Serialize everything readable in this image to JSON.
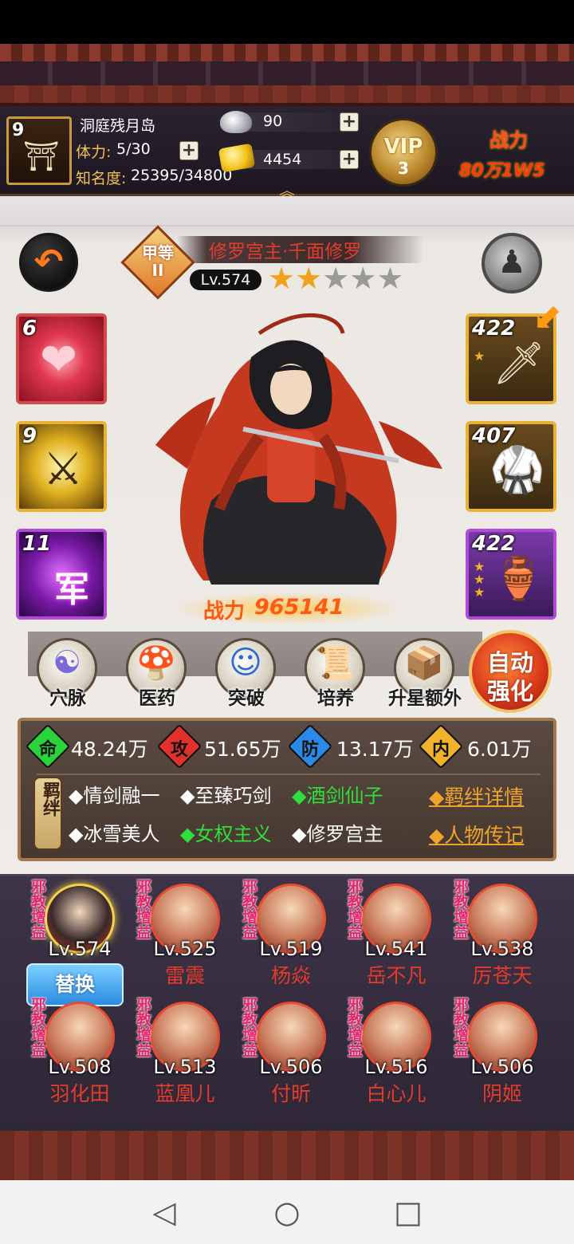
{
  "player": {
    "level": "9",
    "location": "洞庭残月岛",
    "stamina_label": "体力:",
    "stamina_value": "5/30",
    "fame_label": "知名度:",
    "fame_value": "25395/34800",
    "silver": "90",
    "gold": "4454",
    "vip_label": "VIP",
    "vip_level": "3",
    "power_label": "战力",
    "power_value": "80万1W5"
  },
  "hero": {
    "rank_badge": "甲等II",
    "name": "修罗宫主·千面修罗",
    "level": "Lv.574",
    "stars_filled": 2,
    "stars_total": 5,
    "power_label": "战力",
    "power_value": "965141"
  },
  "skills": [
    {
      "level": "6",
      "icon": "heart-swirl-icon"
    },
    {
      "level": "9",
      "icon": "golden-warrior-icon"
    },
    {
      "level": "11",
      "icon": "purple-army-icon",
      "glyph": "军"
    }
  ],
  "equipment": [
    {
      "level": "422",
      "icon": "sword-icon",
      "stars": 1
    },
    {
      "level": "407",
      "icon": "armor-icon",
      "stars": 0
    },
    {
      "level": "422",
      "icon": "wine-jug-icon",
      "stars": 3
    }
  ],
  "menu": [
    {
      "label": "穴脉",
      "icon": "meridian-icon"
    },
    {
      "label": "医药",
      "icon": "medicine-icon"
    },
    {
      "label": "突破",
      "icon": "breakthrough-icon"
    },
    {
      "label": "培养",
      "icon": "cultivate-icon"
    },
    {
      "label": "升星额外",
      "icon": "star-upgrade-icon"
    }
  ],
  "auto_button": {
    "line1": "自动",
    "line2": "强化"
  },
  "stats": [
    {
      "icon": "命",
      "value": "48.24万",
      "color": "#2bd33a"
    },
    {
      "icon": "攻",
      "value": "51.65万",
      "color": "#e2302a"
    },
    {
      "icon": "防",
      "value": "13.17万",
      "color": "#2a8ae8"
    },
    {
      "icon": "内",
      "value": "6.01万",
      "color": "#f2b32a"
    }
  ],
  "bonds": {
    "tag": "羁绊",
    "row1": [
      {
        "text": "◆情剑融一",
        "active": false
      },
      {
        "text": "◆至臻巧剑",
        "active": false
      },
      {
        "text": "◆酒剑仙子",
        "active": true
      }
    ],
    "row2": [
      {
        "text": "◆冰雪美人",
        "active": false
      },
      {
        "text": "◆女权主义",
        "active": true
      },
      {
        "text": "◆修罗宫主",
        "active": false
      }
    ],
    "details_link": "◆羁绊详情",
    "bio_link": "◆人物传记"
  },
  "roster": {
    "tag": "邪教增益",
    "swap_label": "替换",
    "heroes": [
      {
        "level": "Lv.574",
        "name": ""
      },
      {
        "level": "Lv.525",
        "name": "雷震"
      },
      {
        "level": "Lv.519",
        "name": "杨焱"
      },
      {
        "level": "Lv.541",
        "name": "岳不凡"
      },
      {
        "level": "Lv.538",
        "name": "厉苍天"
      },
      {
        "level": "Lv.508",
        "name": "羽化田"
      },
      {
        "level": "Lv.513",
        "name": "蓝凰儿"
      },
      {
        "level": "Lv.506",
        "name": "付昕"
      },
      {
        "level": "Lv.516",
        "name": "白心儿"
      },
      {
        "level": "Lv.506",
        "name": "阴姬"
      }
    ]
  },
  "colors": {
    "accent_gold": "#e8b334",
    "accent_red": "#e63a2a",
    "bond_active": "#2fe03a",
    "link_orange": "#f0a32a"
  }
}
